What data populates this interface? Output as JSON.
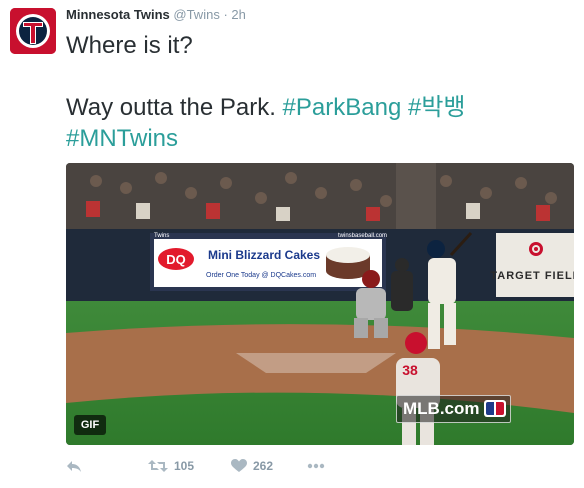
{
  "tweet": {
    "author_name": "Minnesota Twins",
    "handle": "@Twins",
    "separator": "·",
    "time": "2h",
    "text_line1": "Where is it?",
    "text_line3_plain": "Way outta the Park. ",
    "hashtag_parkbang": "#ParkBang",
    "hashtag_korean": "#박뱅",
    "hashtag_mntwins": "#MNTwins"
  },
  "media": {
    "gif_badge": "GIF",
    "watermark": "MLB.com",
    "dq_brand": "DQ",
    "dq_ad_text": "Mini Blizzard Cakes",
    "dq_ad_subtext": "Order One Today @ DQCakes.com",
    "board_brand": "Twins",
    "board_site": "twinsbaseball.com",
    "stadium_sign": "TARGET FIELD",
    "pitcher_number": "38"
  },
  "actions": {
    "retweet_count": "105",
    "like_count": "262"
  },
  "colors": {
    "hashtag": "#2b9e9a",
    "avatar_red": "#c8102e",
    "avatar_navy": "#0c2340",
    "icon_gray": "#aab8c2"
  }
}
